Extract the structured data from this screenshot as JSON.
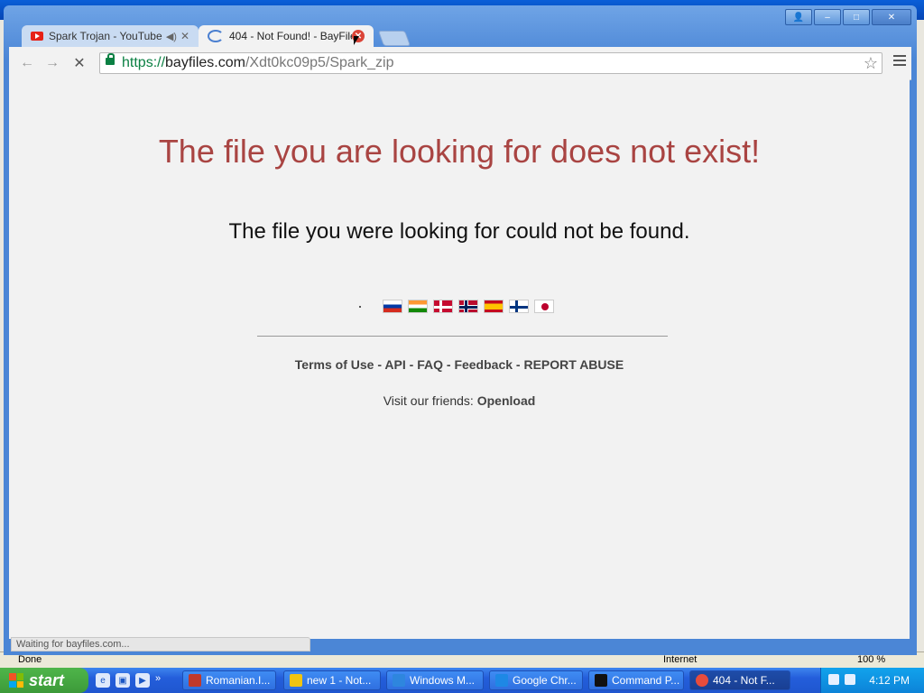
{
  "ie_status": {
    "done": "Done",
    "zone": "Internet",
    "zoom": "100 %"
  },
  "window_controls": {
    "user": "👤",
    "minimize": "–",
    "maximize": "□",
    "close": "✕"
  },
  "tabs": [
    {
      "title": "Spark Trojan - YouTube",
      "audio": "◀)",
      "close": "✕"
    },
    {
      "title": "404 - Not Found! - BayFiles",
      "close": "✕"
    }
  ],
  "toolbar": {
    "back": "←",
    "forward": "→",
    "stop": "✕",
    "url_scheme": "https://",
    "url_host": "bayfiles.com",
    "url_path": "/Xdt0kc09p5/Spark_zip",
    "star": "☆"
  },
  "page": {
    "heading": "The file you are looking for does not exist!",
    "subheading": "The file you were looking for could not be found.",
    "flags": [
      "russia-flag",
      "india-flag",
      "denmark-flag",
      "norway-flag",
      "spain-flag",
      "finland-flag",
      "japan-flag"
    ],
    "links": [
      "Terms of Use",
      "API",
      "FAQ",
      "Feedback",
      "REPORT ABUSE"
    ],
    "link_separator": "-",
    "friends_label": "Visit our friends:",
    "friends_link": "Openload",
    "heading_color": "#a94442"
  },
  "status_bubble": "Waiting for bayfiles.com...",
  "taskbar": {
    "start": "start",
    "tasks": [
      {
        "label": "Romanian.I...",
        "color": "#c0392b"
      },
      {
        "label": "new 1 - Not...",
        "color": "#f1c40f"
      },
      {
        "label": "Windows M...",
        "color": "#2e86de"
      },
      {
        "label": "Google Chr...",
        "color": "#1e88e5"
      },
      {
        "label": "Command P...",
        "color": "#111111"
      },
      {
        "label": "404 - Not F...",
        "color": "#e74c3c"
      }
    ],
    "clock": "4:12 PM"
  }
}
